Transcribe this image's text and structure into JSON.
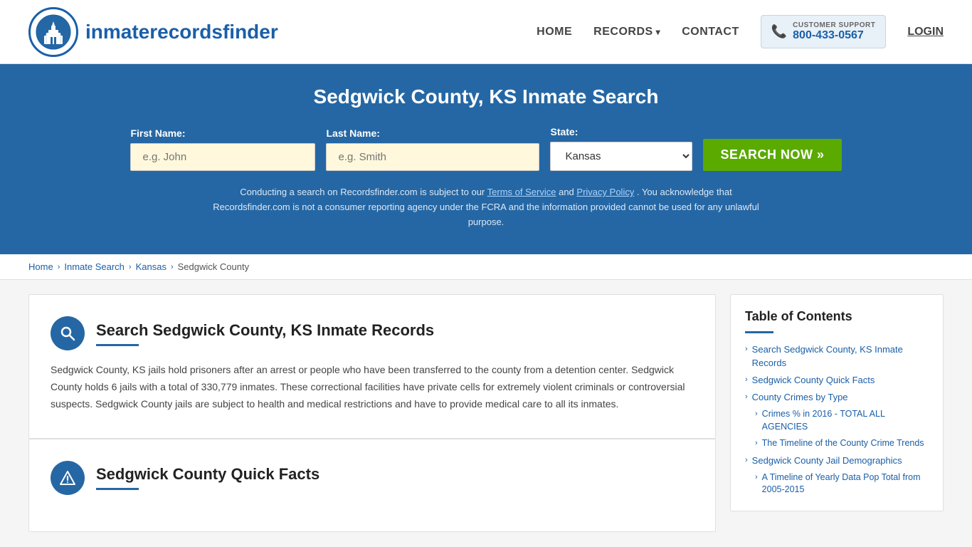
{
  "site": {
    "logo_text_regular": "inmaterecords",
    "logo_text_bold": "finder",
    "tagline": "inmaterecordsfinder"
  },
  "nav": {
    "home": "HOME",
    "records": "RECORDS",
    "contact": "CONTACT",
    "support_label": "CUSTOMER SUPPORT",
    "support_number": "800-433-0567",
    "login": "LOGIN"
  },
  "hero": {
    "title": "Sedgwick County, KS Inmate Search",
    "first_name_label": "First Name:",
    "first_name_placeholder": "e.g. John",
    "last_name_label": "Last Name:",
    "last_name_placeholder": "e.g. Smith",
    "state_label": "State:",
    "state_value": "Kansas",
    "search_button": "SEARCH NOW »",
    "disclaimer_text": "Conducting a search on Recordsfinder.com is subject to our",
    "terms_link": "Terms of Service",
    "and_text": "and",
    "privacy_link": "Privacy Policy",
    "disclaimer_text2": ". You acknowledge that Recordsfinder.com is not a consumer reporting agency under the FCRA and the information provided cannot be used for any unlawful purpose."
  },
  "breadcrumb": {
    "home": "Home",
    "inmate_search": "Inmate Search",
    "kansas": "Kansas",
    "current": "Sedgwick County"
  },
  "main_card": {
    "title": "Search Sedgwick County, KS Inmate Records",
    "body": "Sedgwick County, KS jails hold prisoners after an arrest or people who have been transferred to the county from a detention center. Sedgwick County holds 6 jails with a total of 330,779 inmates. These correctional facilities have private cells for extremely violent criminals or controversial suspects. Sedgwick County jails are subject to health and medical restrictions and have to provide medical care to all its inmates."
  },
  "quick_facts_card": {
    "title": "Sedgwick County Quick Facts"
  },
  "toc": {
    "title": "Table of Contents",
    "items": [
      {
        "label": "Search Sedgwick County, KS Inmate Records",
        "sub": false
      },
      {
        "label": "Sedgwick County Quick Facts",
        "sub": false
      },
      {
        "label": "County Crimes by Type",
        "sub": false
      },
      {
        "label": "Crimes % in 2016 - TOTAL ALL AGENCIES",
        "sub": true
      },
      {
        "label": "The Timeline of the County Crime Trends",
        "sub": true
      },
      {
        "label": "Sedgwick County Jail Demographics",
        "sub": false
      },
      {
        "label": "A Timeline of Yearly Data Pop Total from 2005-2015",
        "sub": true
      }
    ]
  },
  "colors": {
    "primary": "#2567a4",
    "green": "#5aaa00",
    "link": "#1a5fa8"
  }
}
